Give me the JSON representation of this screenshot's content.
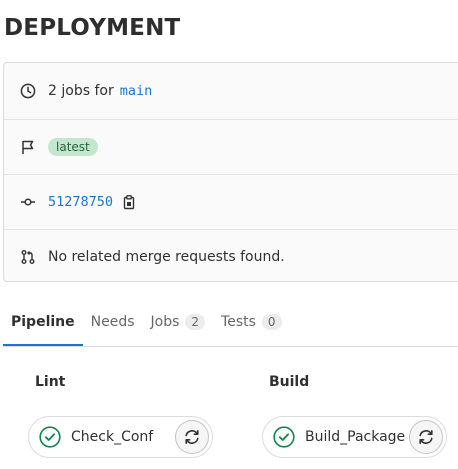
{
  "page": {
    "title": "DEPLOYMENT"
  },
  "info": {
    "jobs_text": "2 jobs for",
    "ref": "main",
    "badge": "latest",
    "commit_sha": "51278750",
    "merge_requests_text": "No related merge requests found."
  },
  "tabs": [
    {
      "label": "Pipeline",
      "active": true
    },
    {
      "label": "Needs"
    },
    {
      "label": "Jobs",
      "count": "2"
    },
    {
      "label": "Tests",
      "count": "0"
    }
  ],
  "stages": [
    {
      "title": "Lint",
      "job": {
        "name": "Check_Conf",
        "status": "passed"
      }
    },
    {
      "title": "Build",
      "job": {
        "name": "Build_Package",
        "status": "passed"
      }
    }
  ],
  "colors": {
    "link": "#1f75cb",
    "success": "#108548",
    "badge_bg": "#c3e6cd"
  }
}
